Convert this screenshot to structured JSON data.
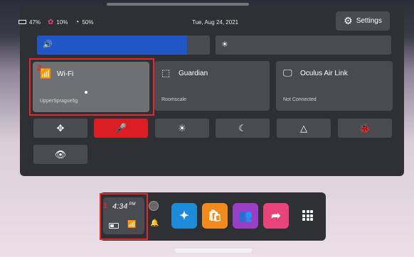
{
  "status": {
    "battery": "47%",
    "controller": "10%",
    "other_device": "50%",
    "date": "Tue, Aug 24, 2021"
  },
  "settings": {
    "label": "Settings",
    "icon": "gear-icon"
  },
  "sliders": {
    "volume": {
      "icon": "speaker-icon",
      "level": 0.87
    },
    "brightness": {
      "icon": "sun-icon",
      "level": 0.0
    }
  },
  "tiles": {
    "wifi": {
      "title": "Wi-Fi",
      "subtitle": "UpperSprague5g",
      "icon": "wifi-icon"
    },
    "guardian": {
      "title": "Guardian",
      "subtitle": "Roomscale",
      "icon": "guardian-icon"
    },
    "airlink": {
      "title": "Oculus Air Link",
      "subtitle": "Not Connected",
      "icon": "airlink-icon"
    }
  },
  "quick_buttons": [
    {
      "name": "move-icon",
      "glyph": "✥",
      "active": false
    },
    {
      "name": "mic-mute-icon",
      "glyph": "🎤",
      "active": true
    },
    {
      "name": "brightness-icon",
      "glyph": "☀",
      "active": false
    },
    {
      "name": "night-mode-icon",
      "glyph": "☾",
      "active": false
    },
    {
      "name": "triangle-icon",
      "glyph": "△",
      "active": false
    },
    {
      "name": "bug-icon",
      "glyph": "🐞",
      "active": false
    },
    {
      "name": "eye-icon",
      "glyph": "👁",
      "active": false
    }
  ],
  "annotations": {
    "one": "1",
    "two": "2"
  },
  "dock": {
    "time": "4:34",
    "ampm": "PM",
    "apps": [
      {
        "name": "explore-app-icon",
        "color": "#1e8bd8",
        "glyph": "✦"
      },
      {
        "name": "store-app-icon",
        "color": "#f08a1c",
        "glyph": "🛍"
      },
      {
        "name": "people-app-icon",
        "color": "#9b3ec7",
        "glyph": "👥"
      },
      {
        "name": "share-app-icon",
        "color": "#e8437a",
        "glyph": "➦"
      }
    ]
  },
  "colors": {
    "accent": "#1f57c8",
    "alert": "#dc1e24",
    "annotation": "#e8262c"
  }
}
